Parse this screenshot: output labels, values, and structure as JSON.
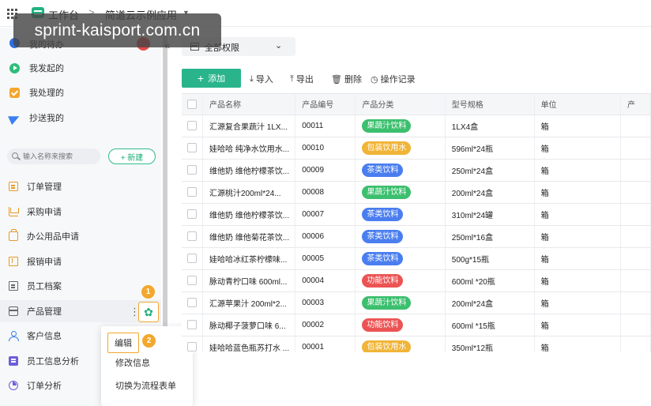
{
  "topbar": {
    "workspace_title": "工作台",
    "separator": ">",
    "app_name": "简道云示例应用"
  },
  "watermark": "sprint-kaisport.com.cn",
  "sidebar": {
    "my_todo": "我的待办",
    "quick_items": [
      {
        "label": "我发起的",
        "icon": "play-circle-icon"
      },
      {
        "label": "我处理的",
        "icon": "check-square-icon"
      },
      {
        "label": "抄送我的",
        "icon": "paper-plane-icon"
      }
    ],
    "search_placeholder": "输入名称来搜索",
    "new_button": "+ 新建",
    "nav_items": [
      {
        "label": "订单管理",
        "icon": "document-icon"
      },
      {
        "label": "采购申请",
        "icon": "cart-icon"
      },
      {
        "label": "办公用品申请",
        "icon": "bag-icon"
      },
      {
        "label": "报销申请",
        "icon": "receipt-icon"
      },
      {
        "label": "员工档案",
        "icon": "file-icon"
      },
      {
        "label": "产品管理",
        "icon": "box-icon"
      },
      {
        "label": "客户信息",
        "icon": "user-icon"
      },
      {
        "label": "员工信息分析",
        "icon": "book-icon"
      },
      {
        "label": "订单分析",
        "icon": "pie-chart-icon"
      }
    ],
    "badge_1": "1",
    "badge_2": "2"
  },
  "context_menu": {
    "items": [
      "编辑",
      "修改信息",
      "切换为流程表单"
    ]
  },
  "main": {
    "permission_select": "全部权限",
    "toolbar": {
      "add": "添加",
      "import": "导入",
      "export": "导出",
      "delete": "删除",
      "log": "操作记录"
    },
    "table": {
      "headers": [
        "产品名称",
        "产品编号",
        "产品分类",
        "型号规格",
        "单位",
        "产"
      ],
      "rows": [
        [
          "汇源复合果蔬汁 1LX...",
          "00011",
          "果蔬汁饮料",
          "1LX4盒",
          "箱"
        ],
        [
          "娃哈哈 纯净水饮用水...",
          "00010",
          "包装饮用水",
          "596ml*24瓶",
          "箱"
        ],
        [
          "维他奶 维他柠檬茶饮...",
          "00009",
          "茶类饮料",
          "250ml*24盒",
          "箱"
        ],
        [
          "汇源桃汁200ml*24...",
          "00008",
          "果蔬汁饮料",
          "200ml*24盒",
          "箱"
        ],
        [
          "维他奶 维他柠檬茶饮...",
          "00007",
          "茶类饮料",
          "310ml*24罐",
          "箱"
        ],
        [
          "维他奶 维他菊花茶饮...",
          "00006",
          "茶类饮料",
          "250ml*16盒",
          "箱"
        ],
        [
          "娃哈哈冰红茶柠檬味...",
          "00005",
          "茶类饮料",
          "500g*15瓶",
          "箱"
        ],
        [
          "脉动青柠口味 600ml...",
          "00004",
          "功能饮料",
          "600ml *20瓶",
          "箱"
        ],
        [
          "汇源苹果汁 200ml*2...",
          "00003",
          "果蔬汁饮料",
          "200ml*24盒",
          "箱"
        ],
        [
          "脉动椰子菠萝口味 6...",
          "00002",
          "功能饮料",
          "600ml *15瓶",
          "箱"
        ],
        [
          "娃哈哈蓝色瓶苏打水 ...",
          "00001",
          "包装饮用水",
          "350ml*12瓶",
          "箱"
        ]
      ]
    },
    "category_colors": {
      "果蔬汁饮料": "#3cbf6e",
      "包装饮用水": "#f0b437",
      "茶类饮料": "#4a7ef0",
      "功能饮料": "#ec5454"
    }
  }
}
